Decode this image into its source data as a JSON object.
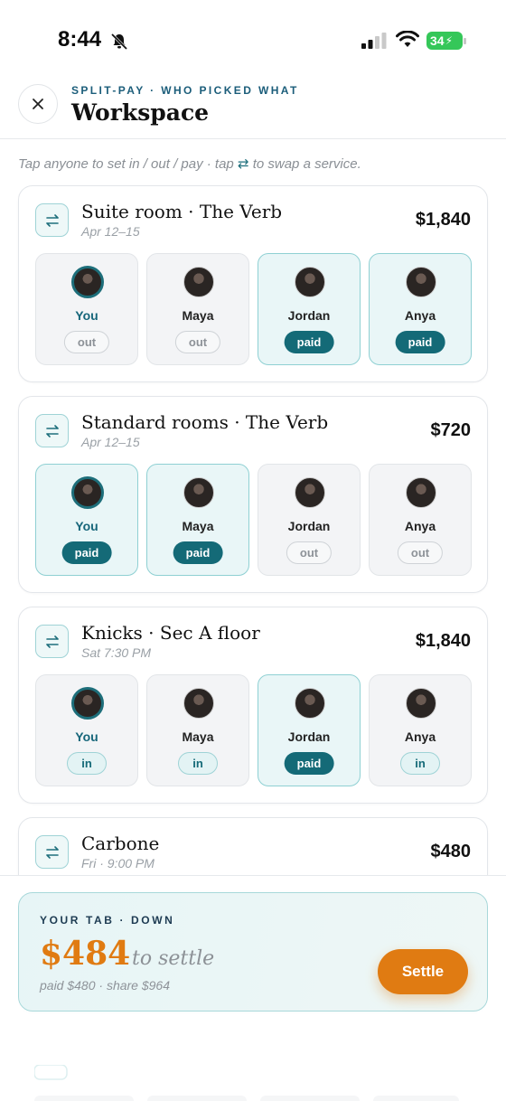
{
  "status": {
    "time": "8:44",
    "battery": "34"
  },
  "header": {
    "eyebrow": "SPLIT-PAY · WHO PICKED WHAT",
    "title": "Workspace"
  },
  "hint": {
    "text": "Tap anyone to set in / out / pay · tap",
    "swap_glyph": "⇄",
    "text_after": "to swap a service."
  },
  "cards": [
    {
      "title": "Suite room · The Verb",
      "subtitle": "Apr 12–15",
      "price": "$1,840",
      "people": [
        {
          "name": "You",
          "status": "out"
        },
        {
          "name": "Maya",
          "status": "out"
        },
        {
          "name": "Jordan",
          "status": "paid"
        },
        {
          "name": "Anya",
          "status": "paid"
        }
      ]
    },
    {
      "title": "Standard rooms · The Verb",
      "subtitle": "Apr 12–15",
      "price": "$720",
      "people": [
        {
          "name": "You",
          "status": "paid"
        },
        {
          "name": "Maya",
          "status": "paid"
        },
        {
          "name": "Jordan",
          "status": "out"
        },
        {
          "name": "Anya",
          "status": "out"
        }
      ]
    },
    {
      "title": "Knicks · Sec A floor",
      "subtitle": "Sat 7:30 PM",
      "price": "$1,840",
      "people": [
        {
          "name": "You",
          "status": "in"
        },
        {
          "name": "Maya",
          "status": "in"
        },
        {
          "name": "Jordan",
          "status": "paid"
        },
        {
          "name": "Anya",
          "status": "in"
        }
      ]
    },
    {
      "title": "Carbone",
      "subtitle": "Fri · 9:00 PM",
      "price": "$480"
    }
  ],
  "tab": {
    "eyebrow": "YOUR TAB · DOWN",
    "amount": "$484",
    "settle_word": "to settle",
    "sub": "paid $480 · share $964",
    "settle_button": "Settle"
  },
  "colors": {
    "accent": "#146a77",
    "orange": "#e07b12",
    "tint": "#e9f6f7"
  }
}
